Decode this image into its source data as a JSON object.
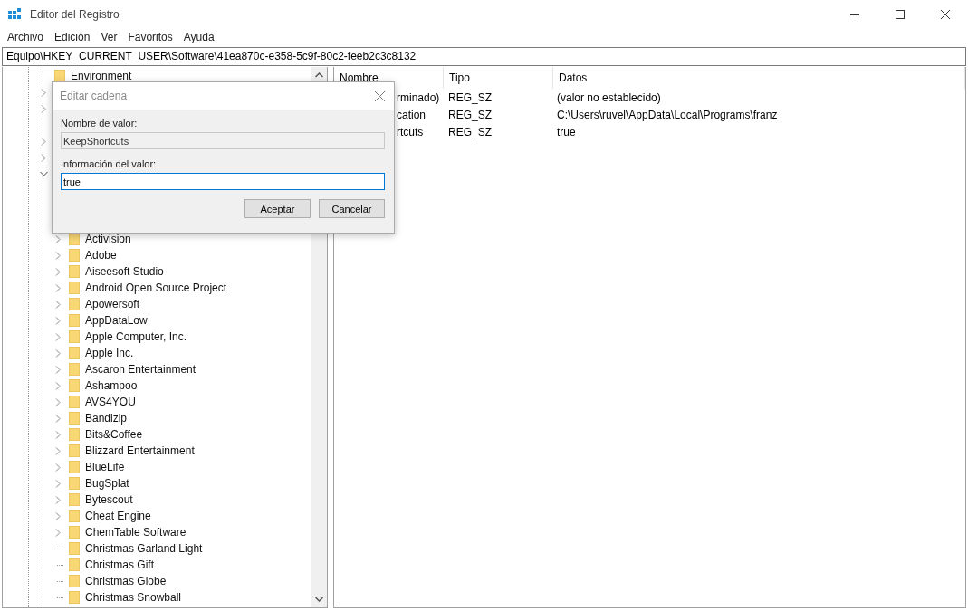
{
  "window": {
    "title": "Editor del Registro"
  },
  "menu": [
    "Archivo",
    "Edición",
    "Ver",
    "Favoritos",
    "Ayuda"
  ],
  "address": "Equipo\\HKEY_CURRENT_USER\\Software\\41ea870c-e358-5c9f-80c2-feeb2c3c8132",
  "tree": {
    "rows": [
      {
        "label": "Environment",
        "kind": "leaf"
      },
      {
        "kind": "collapsed"
      },
      {
        "kind": "collapsed"
      },
      {
        "kind": "leaf"
      },
      {
        "kind": "collapsed"
      },
      {
        "kind": "collapsed"
      },
      {
        "kind": "expanded",
        "children": [
          {
            "label": "Activision",
            "kind": "collapsed"
          },
          {
            "label": "Adobe",
            "kind": "collapsed"
          },
          {
            "label": "Aiseesoft Studio",
            "kind": "collapsed"
          },
          {
            "label": "Android Open Source Project",
            "kind": "collapsed"
          },
          {
            "label": "Apowersoft",
            "kind": "collapsed"
          },
          {
            "label": "AppDataLow",
            "kind": "collapsed"
          },
          {
            "label": "Apple Computer, Inc.",
            "kind": "collapsed"
          },
          {
            "label": "Apple Inc.",
            "kind": "collapsed"
          },
          {
            "label": "Ascaron Entertainment",
            "kind": "collapsed"
          },
          {
            "label": "Ashampoo",
            "kind": "collapsed"
          },
          {
            "label": "AVS4YOU",
            "kind": "collapsed"
          },
          {
            "label": "Bandizip",
            "kind": "collapsed"
          },
          {
            "label": "Bits&Coffee",
            "kind": "collapsed"
          },
          {
            "label": "Blizzard Entertainment",
            "kind": "collapsed"
          },
          {
            "label": "BlueLife",
            "kind": "collapsed"
          },
          {
            "label": "BugSplat",
            "kind": "collapsed"
          },
          {
            "label": "Bytescout",
            "kind": "collapsed"
          },
          {
            "label": "Cheat Engine",
            "kind": "collapsed"
          },
          {
            "label": "ChemTable Software",
            "kind": "collapsed"
          },
          {
            "label": "Christmas Garland Light",
            "kind": "leaf"
          },
          {
            "label": "Christmas Gift",
            "kind": "leaf"
          },
          {
            "label": "Christmas Globe",
            "kind": "leaf"
          },
          {
            "label": "Christmas Snowball",
            "kind": "leaf"
          }
        ]
      }
    ]
  },
  "values": {
    "columns": [
      "Nombre",
      "Tipo",
      "Datos"
    ],
    "rows": [
      {
        "name": "rminado)",
        "type": "REG_SZ",
        "data": "(valor no establecido)"
      },
      {
        "name": "cation",
        "type": "REG_SZ",
        "data": "C:\\Users\\ruvel\\AppData\\Local\\Programs\\franz"
      },
      {
        "name": "rtcuts",
        "type": "REG_SZ",
        "data": "true"
      }
    ]
  },
  "dialog": {
    "title": "Editar cadena",
    "name_label": "Nombre de valor:",
    "name_value": "KeepShortcuts",
    "data_label": "Información del valor:",
    "data_value": "true",
    "buttons": [
      "Aceptar",
      "Cancelar"
    ]
  }
}
